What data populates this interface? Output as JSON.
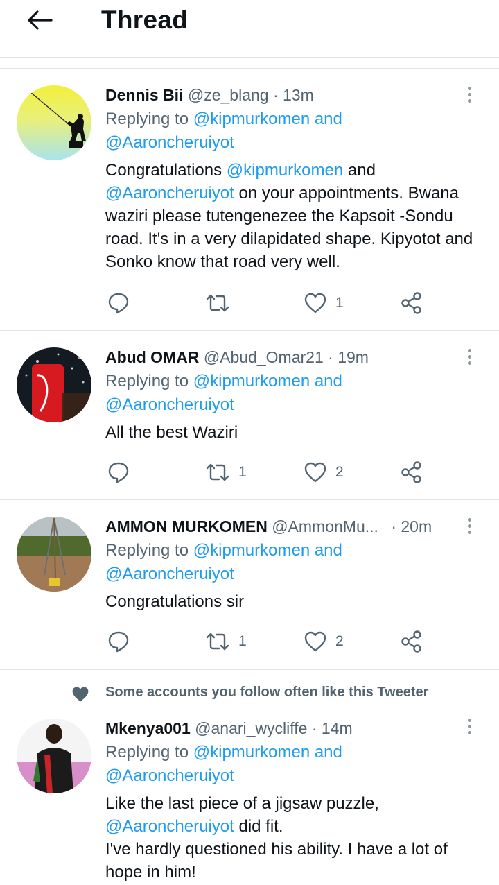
{
  "header": {
    "title": "Thread",
    "back_icon": "arrow-left-icon"
  },
  "tweets": [
    {
      "name": "Dennis Bii",
      "handle": "@ze_blang",
      "time": "· 13m",
      "replying_prefix": "Replying to ",
      "replying_to": "@kipmurkomen and",
      "replying_to_2": "@Aaroncheruiyot",
      "reply_count": "",
      "retweet_count": "",
      "like_count": "1",
      "body": {
        "t1": "Congratulations ",
        "m1": "@kipmurkomen",
        "t2": " and",
        "m2": "@Aaroncheruiyot",
        "t3": " on your appointments. Bwana waziri please tutengenezee the Kapsoit -Sondu road. It's in a very  dilapidated shape. Kipyotot and Sonko know that road very well."
      }
    },
    {
      "name": "Abud OMAR",
      "handle": "@Abud_Omar21",
      "time": "· 19m",
      "replying_prefix": "Replying to ",
      "replying_to": "@kipmurkomen and",
      "replying_to_2": "@Aaroncheruiyot",
      "reply_count": "",
      "retweet_count": "1",
      "like_count": "2",
      "body": {
        "text": "All the best Waziri"
      }
    },
    {
      "name": "AMMON MURKOMEN",
      "handle": "@AmmonMu...",
      "time": "· 20m",
      "replying_prefix": "Replying to ",
      "replying_to": "@kipmurkomen and",
      "replying_to_2": "@Aaroncheruiyot",
      "reply_count": "",
      "retweet_count": "1",
      "like_count": "2",
      "body": {
        "text": "Congratulations sir"
      }
    },
    {
      "social_context": "Some accounts you follow often like this Tweeter",
      "name": "Mkenya001",
      "handle": "@anari_wycliffe",
      "time": "· 14m",
      "replying_prefix": "Replying to ",
      "replying_to": "@kipmurkomen and",
      "replying_to_2": "@Aaroncheruiyot",
      "body": {
        "t1": "Like the last piece of a jigsaw puzzle,",
        "m1": "@Aaroncheruiyot",
        "t2": " did fit.",
        "t3": "I've hardly questioned his ability. I have a lot of hope in him!"
      }
    }
  ],
  "colors": {
    "link": "#1d9bf0",
    "secondary": "#536471",
    "divider": "#e1e4e7",
    "text": "#0f1419"
  }
}
